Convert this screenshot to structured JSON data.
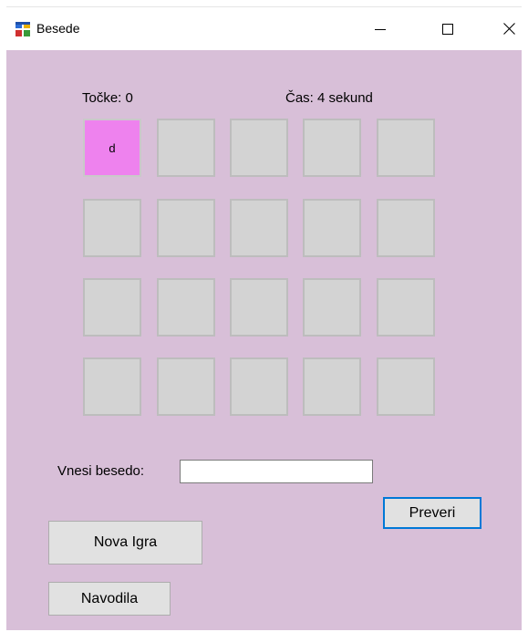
{
  "window": {
    "title": "Besede",
    "icon": "app-window-icon"
  },
  "titlebar": {
    "minimize_icon": "minimize-icon",
    "maximize_icon": "maximize-icon",
    "close_icon": "close-icon"
  },
  "status": {
    "score_label": "Točke: 0",
    "time_label": "Čas: 4 sekund"
  },
  "grid": {
    "rows": 4,
    "cols": 5,
    "tiles": [
      "d",
      "",
      "",
      "",
      "",
      "",
      "",
      "",
      "",
      "",
      "",
      "",
      "",
      "",
      "",
      "",
      "",
      "",
      "",
      ""
    ],
    "selected_index": 0
  },
  "input": {
    "label": "Vnesi besedo:",
    "value": ""
  },
  "buttons": {
    "check": "Preveri",
    "new_game": "Nova Igra",
    "instructions": "Navodila"
  },
  "colors": {
    "background": "#d8bfd8",
    "tile": "#d3d3d3",
    "tile_selected": "#ee82ee",
    "default_button_border": "#0078d7"
  }
}
